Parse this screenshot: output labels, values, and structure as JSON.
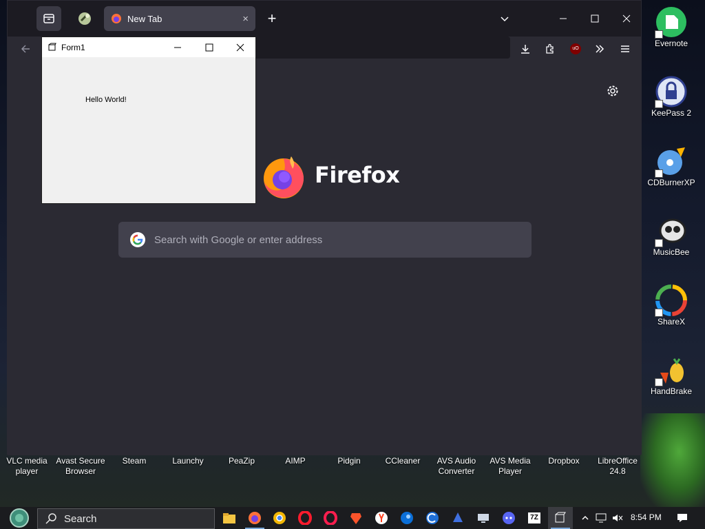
{
  "firefox": {
    "tab_title": "New Tab",
    "tab_close": "×",
    "new_tab": "+",
    "wordmark": "Firefox",
    "search_placeholder": "Search with Google or enter address",
    "ublock_badge": "uO"
  },
  "form1": {
    "title": "Form1",
    "label": "Hello World!"
  },
  "desktop_right": [
    {
      "label": "Evernote",
      "icon": "evernote-icon"
    },
    {
      "label": "KeePass 2",
      "icon": "keepass-icon"
    },
    {
      "label": "CDBurnerXP",
      "icon": "cdburnerxp-icon"
    },
    {
      "label": "MusicBee",
      "icon": "musicbee-icon"
    },
    {
      "label": "ShareX",
      "icon": "sharex-icon"
    },
    {
      "label": "HandBrake",
      "icon": "handbrake-icon"
    }
  ],
  "desktop_bottom": [
    {
      "line1": "VLC media",
      "line2": "player"
    },
    {
      "line1": "Avast Secure",
      "line2": "Browser"
    },
    {
      "line1": "Steam",
      "line2": ""
    },
    {
      "line1": "Launchy",
      "line2": ""
    },
    {
      "line1": "PeaZip",
      "line2": ""
    },
    {
      "line1": "AIMP",
      "line2": ""
    },
    {
      "line1": "Pidgin",
      "line2": ""
    },
    {
      "line1": "CCleaner",
      "line2": ""
    },
    {
      "line1": "AVS Audio",
      "line2": "Converter"
    },
    {
      "line1": "AVS Media",
      "line2": "Player"
    },
    {
      "line1": "Dropbox",
      "line2": ""
    },
    {
      "line1": "LibreOffice",
      "line2": "24.8"
    }
  ],
  "taskbar": {
    "search_label": "Search",
    "clock": "8:54 PM",
    "seven_zip_label": "7Z",
    "apps": [
      "file-explorer-icon",
      "firefox-icon",
      "chrome-icon",
      "opera-icon",
      "opera-gx-icon",
      "brave-icon",
      "yandex-icon",
      "waterfox-icon",
      "ccleaner-icon",
      "blue-app-icon",
      "remote-desktop-icon",
      "discord-icon",
      "7zip-icon",
      "form1-app-icon"
    ]
  },
  "colors": {
    "ff_bg": "#1c1b22",
    "ff_content": "#2b2a33",
    "ff_field": "#42414d",
    "taskbar": "#1b1c1f"
  }
}
